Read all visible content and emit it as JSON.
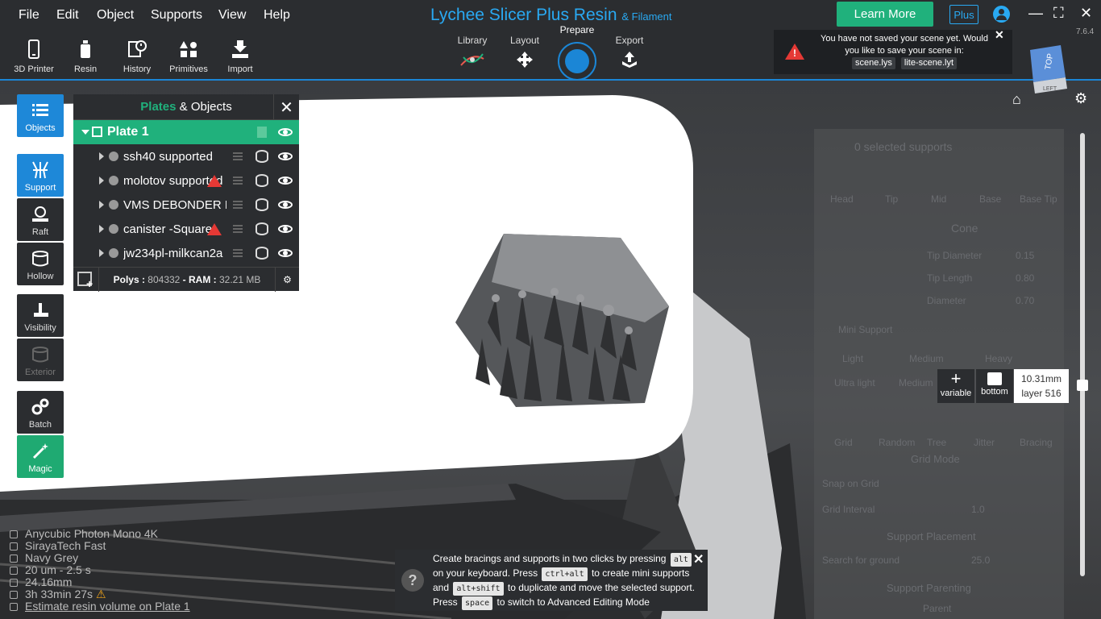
{
  "menu": [
    "File",
    "Edit",
    "Object",
    "Supports",
    "View",
    "Help"
  ],
  "brand": {
    "main": "Lychee Slicer Plus Resin",
    "sub": "& Filament"
  },
  "header": {
    "learn_more": "Learn More",
    "plus": "Plus",
    "version": "7.6.4"
  },
  "toolbar": [
    {
      "label": "3D Printer",
      "icon": "phone-printer-icon"
    },
    {
      "label": "Resin",
      "icon": "resin-bottle-icon"
    },
    {
      "label": "History",
      "icon": "history-icon"
    },
    {
      "label": "Primitives",
      "icon": "primitives-icon"
    },
    {
      "label": "Import",
      "icon": "import-icon"
    }
  ],
  "workflow_tabs": {
    "library": "Library",
    "layout": "Layout",
    "prepare": "Prepare",
    "export": "Export"
  },
  "notice": {
    "text": "You have not saved your scene yet. Would you like to save your scene in:",
    "option1": "scene.lys",
    "option2": "lite-scene.lyt"
  },
  "left_tools": [
    "Objects",
    "Support",
    "Raft",
    "Hollow",
    "Visibility",
    "Exterior",
    "Batch",
    "Magic"
  ],
  "plates_panel": {
    "title_a": "Plates",
    "title_amp": " & ",
    "title_b": "Objects",
    "plate": "Plate 1",
    "objects": [
      {
        "name": "ssh40 supported",
        "warn": false
      },
      {
        "name": "molotov supported",
        "warn": true
      },
      {
        "name": "VMS DEBONDER H",
        "warn": false
      },
      {
        "name": "canister -Square",
        "warn": true
      },
      {
        "name": "jw234pl-milkcan2a",
        "warn": false
      }
    ],
    "polys_label": "Polys : ",
    "polys_value": "804332",
    "ram_label": " - RAM : ",
    "ram_value": "32.21 MB"
  },
  "layer": {
    "variable": "variable",
    "bottom": "bottom",
    "height": "10.31mm",
    "layer": "layer 516"
  },
  "view_cube": {
    "top": "TOP",
    "left": "LEFT"
  },
  "ghost_panel": {
    "selected": "0 selected supports",
    "types": [
      "Head",
      "Tip",
      "Mid",
      "Base",
      "Base Tip"
    ],
    "shape": "Cone",
    "params": [
      "Tip Diameter",
      "Tip Length",
      "Diameter"
    ],
    "values": [
      "0.15",
      "0.80",
      "0.70"
    ],
    "mini": "Mini Support",
    "presets": [
      "Light",
      "Medium",
      "Heavy",
      "Ultra light",
      "Medium"
    ],
    "modes": [
      "Grid",
      "Random",
      "Tree",
      "Jitter",
      "Bracing"
    ],
    "grid_mode": "Grid Mode",
    "snap": "Snap on Grid",
    "grid_interval": "Grid Interval",
    "grid_interval_value": "1.0",
    "placement": "Support Placement",
    "search_ground": "Search for ground",
    "search_ground_value": "25.0",
    "parenting": "Support Parenting",
    "parent": "Parent"
  },
  "info": {
    "printer": "Anycubic Photon Mono 4K",
    "resin": "SirayaTech Fast",
    "color": "Navy Grey",
    "layer": "20 um - 2.5 s",
    "height": "24.16mm",
    "time": "3h 33min 27s",
    "estimate": "Estimate resin volume on Plate 1"
  },
  "tip": {
    "p1": "Create bracings and supports in two clicks by pressing",
    "k1": "alt",
    "p2": "on your keyboard. Press",
    "k2": "ctrl+alt",
    "p3": "to create mini supports and",
    "k3": "alt+shift",
    "p4": "to duplicate and move the selected support. Press",
    "k4": "space",
    "p5": "to switch to Advanced Editing Mode"
  }
}
